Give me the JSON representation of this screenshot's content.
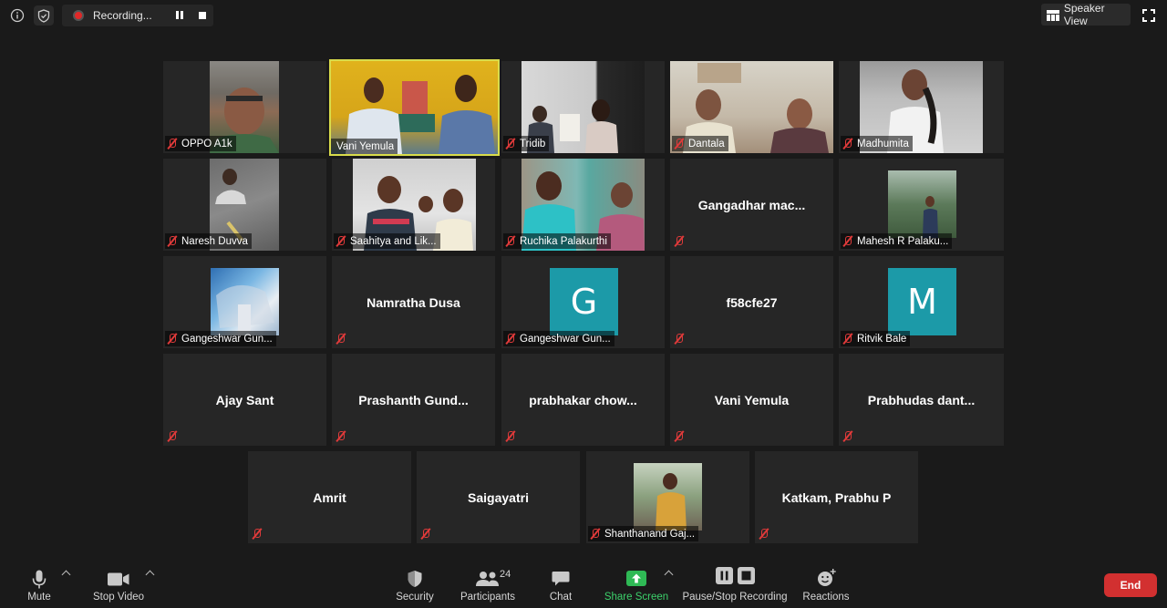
{
  "top_bar": {
    "recording_label": "Recording...",
    "speaker_view_label": "Speaker View"
  },
  "tiles": {
    "r1": [
      "OPPO A1k",
      "Vani Yemula",
      "Tridib",
      "Dantala",
      "Madhumita"
    ],
    "r2": [
      "Naresh Duvva",
      "Saahitya and Lik...",
      "Ruchika Palakurthi",
      "Gangadhar  mac...",
      "Mahesh R Palaku..."
    ],
    "r3": [
      "Gangeshwar Gun...",
      "Namratha Dusa",
      "Gangeshwar Gun...",
      "f58cfe27",
      "Ritvik Bale"
    ],
    "r4": [
      "Ajay Sant",
      "Prashanth  Gund...",
      "prabhakar  chow...",
      "Vani Yemula",
      "Prabhudas  dant..."
    ],
    "r5": [
      "Amrit",
      "Saigayatri",
      "Shanthanand Gaj...",
      "Katkam, Prabhu P"
    ],
    "avatar_letters": {
      "gangeshwar": "G",
      "ritvik": "M"
    }
  },
  "toolbar": {
    "mute": "Mute",
    "stop_video": "Stop Video",
    "security": "Security",
    "participants": "Participants",
    "participant_count": "24",
    "chat": "Chat",
    "share_screen": "Share Screen",
    "pause_stop_recording": "Pause/Stop Recording",
    "reactions": "Reactions",
    "end": "End"
  },
  "colors": {
    "background": "#1a1a1a",
    "tile": "#262626",
    "active_speaker_border": "#d9dc4b",
    "muted_red": "#e03a3a",
    "avatar_teal": "#1c9aa8",
    "share_green": "#3cd16b",
    "end_red": "#d23030"
  }
}
